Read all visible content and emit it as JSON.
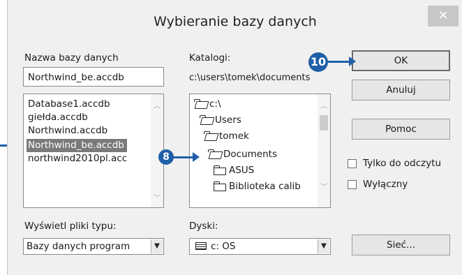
{
  "window": {
    "title": "Wybieranie bazy danych",
    "close_glyph": "✕"
  },
  "database_name": {
    "label": "Nazwa bazy danych",
    "value": "Northwind_be.accdb"
  },
  "database_list": {
    "items": [
      "Database1.accdb",
      "giełda.accdb",
      "Northwind.accdb",
      "Northwind_be.accdb",
      "northwind2010pl.acc"
    ],
    "selected_index": 3
  },
  "folders": {
    "label": "Katalogi:",
    "current_path": "c:\\users\\tomek\\documents",
    "items": [
      "c:\\",
      "Users",
      "tomek",
      "Documents",
      "ASUS",
      "Biblioteka calib"
    ],
    "open_index": 3
  },
  "buttons": {
    "ok": "OK",
    "cancel": "Anuluj",
    "help": "Pomoc",
    "network": "Sieć..."
  },
  "checkboxes": {
    "read_only": {
      "label": "Tylko do odczytu",
      "checked": false
    },
    "exclusive": {
      "label": "Wyłączny",
      "checked": false
    }
  },
  "file_type": {
    "label": "Wyświetl pliki typu:",
    "value": "Bazy danych program"
  },
  "drives": {
    "label": "Dyski:",
    "value": "c: OS"
  },
  "callouts": {
    "eight": "8",
    "ten": "10"
  },
  "colors": {
    "accent": "#1f5fa8",
    "selection": "#7a7a7a",
    "dialog_bg": "#f0f0f0"
  }
}
